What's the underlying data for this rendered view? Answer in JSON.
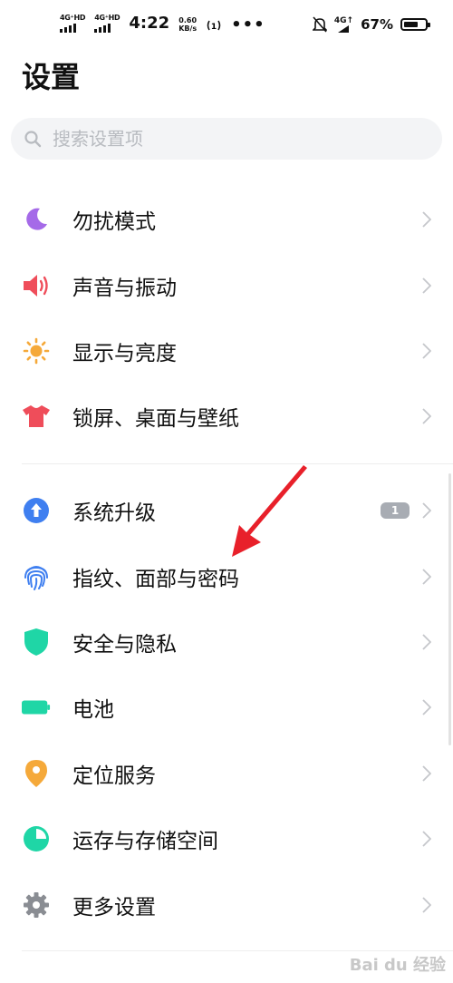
{
  "status_bar": {
    "net1": "4G⁺HD",
    "net2": "4G⁺HD",
    "time": "4:22",
    "speed_value": "0.60",
    "speed_unit": "KB/s",
    "more": "•••",
    "net3": "4G↑",
    "battery_percent": "67%",
    "battery_level": 0.67
  },
  "page_title": "设置",
  "search": {
    "placeholder": "搜索设置项"
  },
  "groups": [
    {
      "items": [
        {
          "label": "勿扰模式",
          "icon": "moon-icon",
          "color": "#a56ae8"
        },
        {
          "label": "声音与振动",
          "icon": "speaker-icon",
          "color": "#ef4d5a"
        },
        {
          "label": "显示与亮度",
          "icon": "sun-icon",
          "color": "#f5a93a"
        },
        {
          "label": "锁屏、桌面与壁纸",
          "icon": "tshirt-icon",
          "color": "#ef4d5a"
        }
      ]
    },
    {
      "items": [
        {
          "label": "系统升级",
          "icon": "upgrade-icon",
          "color": "#3f7ff0",
          "badge": "1"
        },
        {
          "label": "指纹、面部与密码",
          "icon": "fingerprint-icon",
          "color": "#3f7ff0"
        },
        {
          "label": "安全与隐私",
          "icon": "shield-icon",
          "color": "#1fd6a6"
        },
        {
          "label": "电池",
          "icon": "battery-icon",
          "color": "#1fd6a6"
        },
        {
          "label": "定位服务",
          "icon": "location-pin-icon",
          "color": "#f5a93a"
        },
        {
          "label": "运存与存储空间",
          "icon": "pie-chart-icon",
          "color": "#1fd6a6"
        },
        {
          "label": "更多设置",
          "icon": "gear-icon",
          "color": "#8a8d93"
        }
      ]
    }
  ],
  "annotation": {
    "arrow_color": "#e8202a"
  },
  "watermark": "Bai du 经验"
}
